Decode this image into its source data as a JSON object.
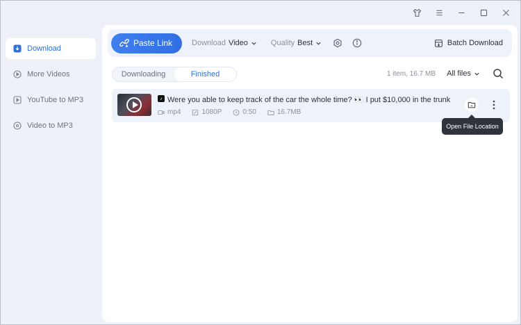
{
  "window": {
    "controls": [
      "shirt-icon",
      "menu-icon",
      "minimize-icon",
      "maximize-icon",
      "close-icon"
    ]
  },
  "sidebar": {
    "items": [
      {
        "label": "Download",
        "icon": "download-icon",
        "active": true
      },
      {
        "label": "More Videos",
        "icon": "play-circle-icon",
        "active": false
      },
      {
        "label": "YouTube to MP3",
        "icon": "play-square-icon",
        "active": false
      },
      {
        "label": "Video to MP3",
        "icon": "music-disc-icon",
        "active": false
      }
    ]
  },
  "toolbar": {
    "paste_label": "Paste Link",
    "download_prefix": "Download",
    "download_value": "Video",
    "quality_prefix": "Quality",
    "quality_value": "Best",
    "batch_label": "Batch Download"
  },
  "tabs": [
    {
      "label": "Downloading",
      "active": false
    },
    {
      "label": "Finished",
      "active": true
    }
  ],
  "summary": "1 item, 16.7 MB",
  "filter_label": "All files",
  "items": [
    {
      "title": "Were you able to keep track of the car the whole time? 👀 I put $10,000 in the trunk ...",
      "format": "mp4",
      "resolution": "1080P",
      "duration": "0:50",
      "size": "16.7MB"
    }
  ],
  "tooltip": "Open File Location",
  "colors": {
    "accent": "#2f6fd6",
    "background": "#eef2f8",
    "tooltip": "#2f333c"
  }
}
